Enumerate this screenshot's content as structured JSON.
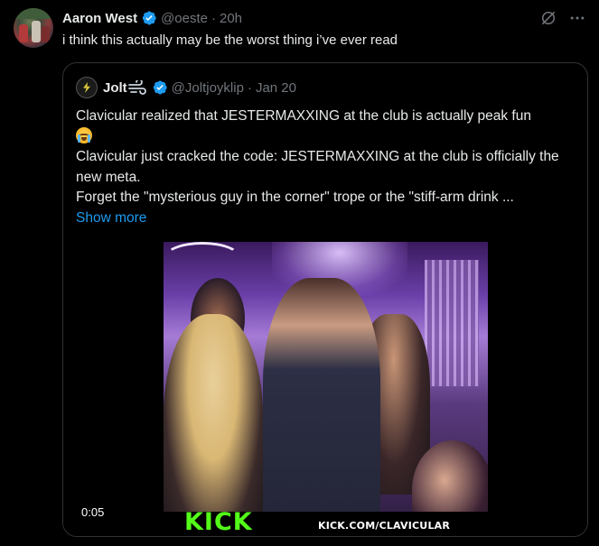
{
  "tweet": {
    "author_name": "Aaron West",
    "author_handle": "@oeste",
    "separator": "·",
    "time": "20h",
    "text": "i think this actually may be the worst thing i’ve ever read"
  },
  "quote": {
    "author_name": "Jolt",
    "author_handle": "@Joltjoyklip",
    "separator": "·",
    "date": "Jan 20",
    "line1": "Clavicular realized that JESTERMAXXING at the club is actually peak fun",
    "line2": "Clavicular just cracked the code: JESTERMAXXING at the club is officially the new meta.",
    "line3": "Forget the \"mysterious guy in the corner\" trope or the \"stiff-arm drink ...",
    "show_more": "Show more",
    "video": {
      "timestamp": "0:05",
      "watermark_logo": "KICK",
      "watermark_url": "KICK.COM/CLAVICULAR"
    }
  },
  "icons": {
    "verified": "verified-badge-icon",
    "grok": "grok-icon",
    "more": "more-icon",
    "wind_emoji": "dashing-away-emoji",
    "cry_emoji": "loudly-crying-emoji"
  },
  "colors": {
    "background": "#000000",
    "text": "#e7e9ea",
    "muted": "#71767b",
    "link": "#1d9bf0",
    "verified": "#1d9bf0",
    "border": "#2f3336",
    "kick_green": "#53fc18"
  }
}
